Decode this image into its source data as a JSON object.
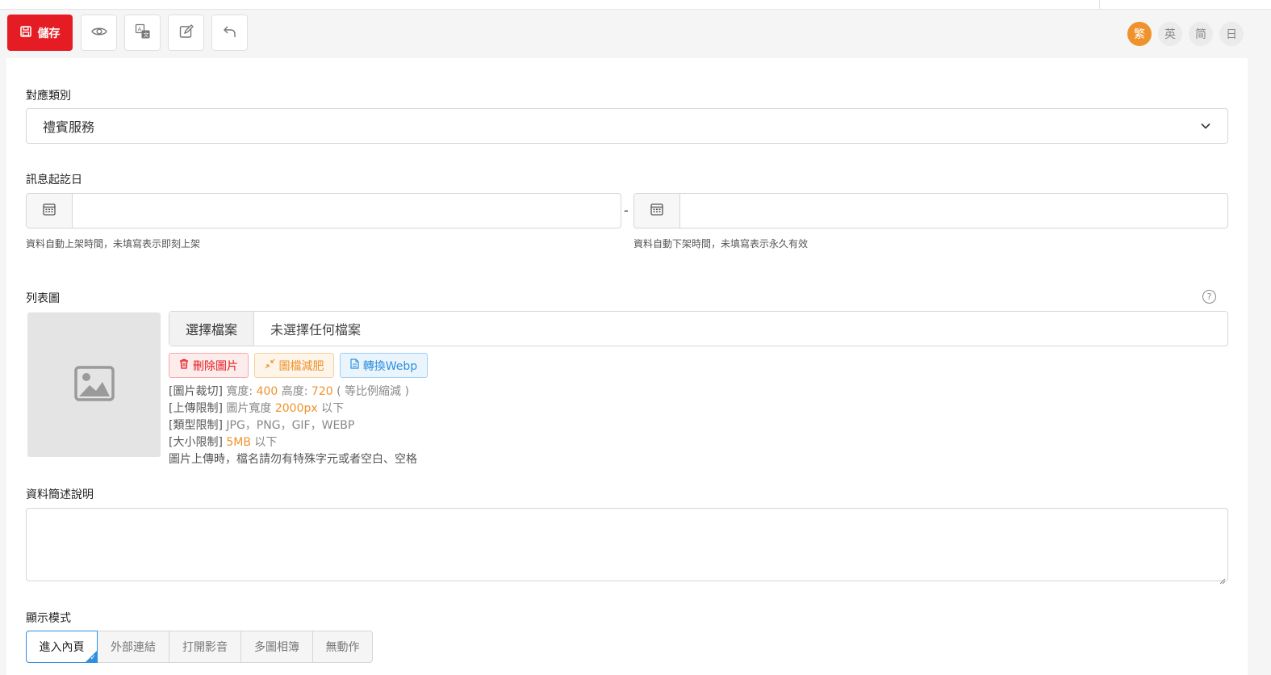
{
  "toolbar": {
    "save_label": "儲存",
    "languages": [
      "繁",
      "英",
      "简",
      "日"
    ],
    "active_language": "繁",
    "accent_color": "#e51c23",
    "active_language_color": "#f0922b"
  },
  "form": {
    "category": {
      "label": "對應類別",
      "value": "禮賓服務"
    },
    "date_range": {
      "label": "訊息起訖日",
      "start_value": "",
      "end_value": "",
      "separator": "-",
      "start_hint": "資料自動上架時間，未填寫表示即刻上架",
      "end_hint": "資料自動下架時間，未填寫表示永久有效"
    },
    "list_image": {
      "label": "列表圖",
      "help": "?",
      "choose_label": "選擇檔案",
      "file_name": "未選擇任何檔案",
      "delete_label": "刪除圖片",
      "compress_label": "圖檔減肥",
      "webp_label": "轉換Webp",
      "crop_key": "[圖片裁切]",
      "crop_w_label": "寬度: ",
      "crop_w": "400",
      "crop_h_label": " 高度: ",
      "crop_h": "720",
      "crop_note": " ( 等比例縮減 )",
      "upload_key": "[上傳限制]",
      "upload_label": " 圖片寬度 ",
      "upload_value": "2000px",
      "upload_suffix": " 以下",
      "type_key": "[類型限制]",
      "type_value": " JPG，PNG，GIF，WEBP",
      "size_key": "[大小限制]",
      "size_value": "5MB",
      "size_suffix": " 以下",
      "filename_note": "圖片上傳時，檔名請勿有特殊字元或者空白、空格"
    },
    "description": {
      "label": "資料簡述說明",
      "value": ""
    },
    "display_mode": {
      "label": "顯示模式",
      "options": [
        "進入內頁",
        "外部連結",
        "打開影音",
        "多圖相簿",
        "無動作"
      ],
      "selected": "進入內頁"
    }
  }
}
